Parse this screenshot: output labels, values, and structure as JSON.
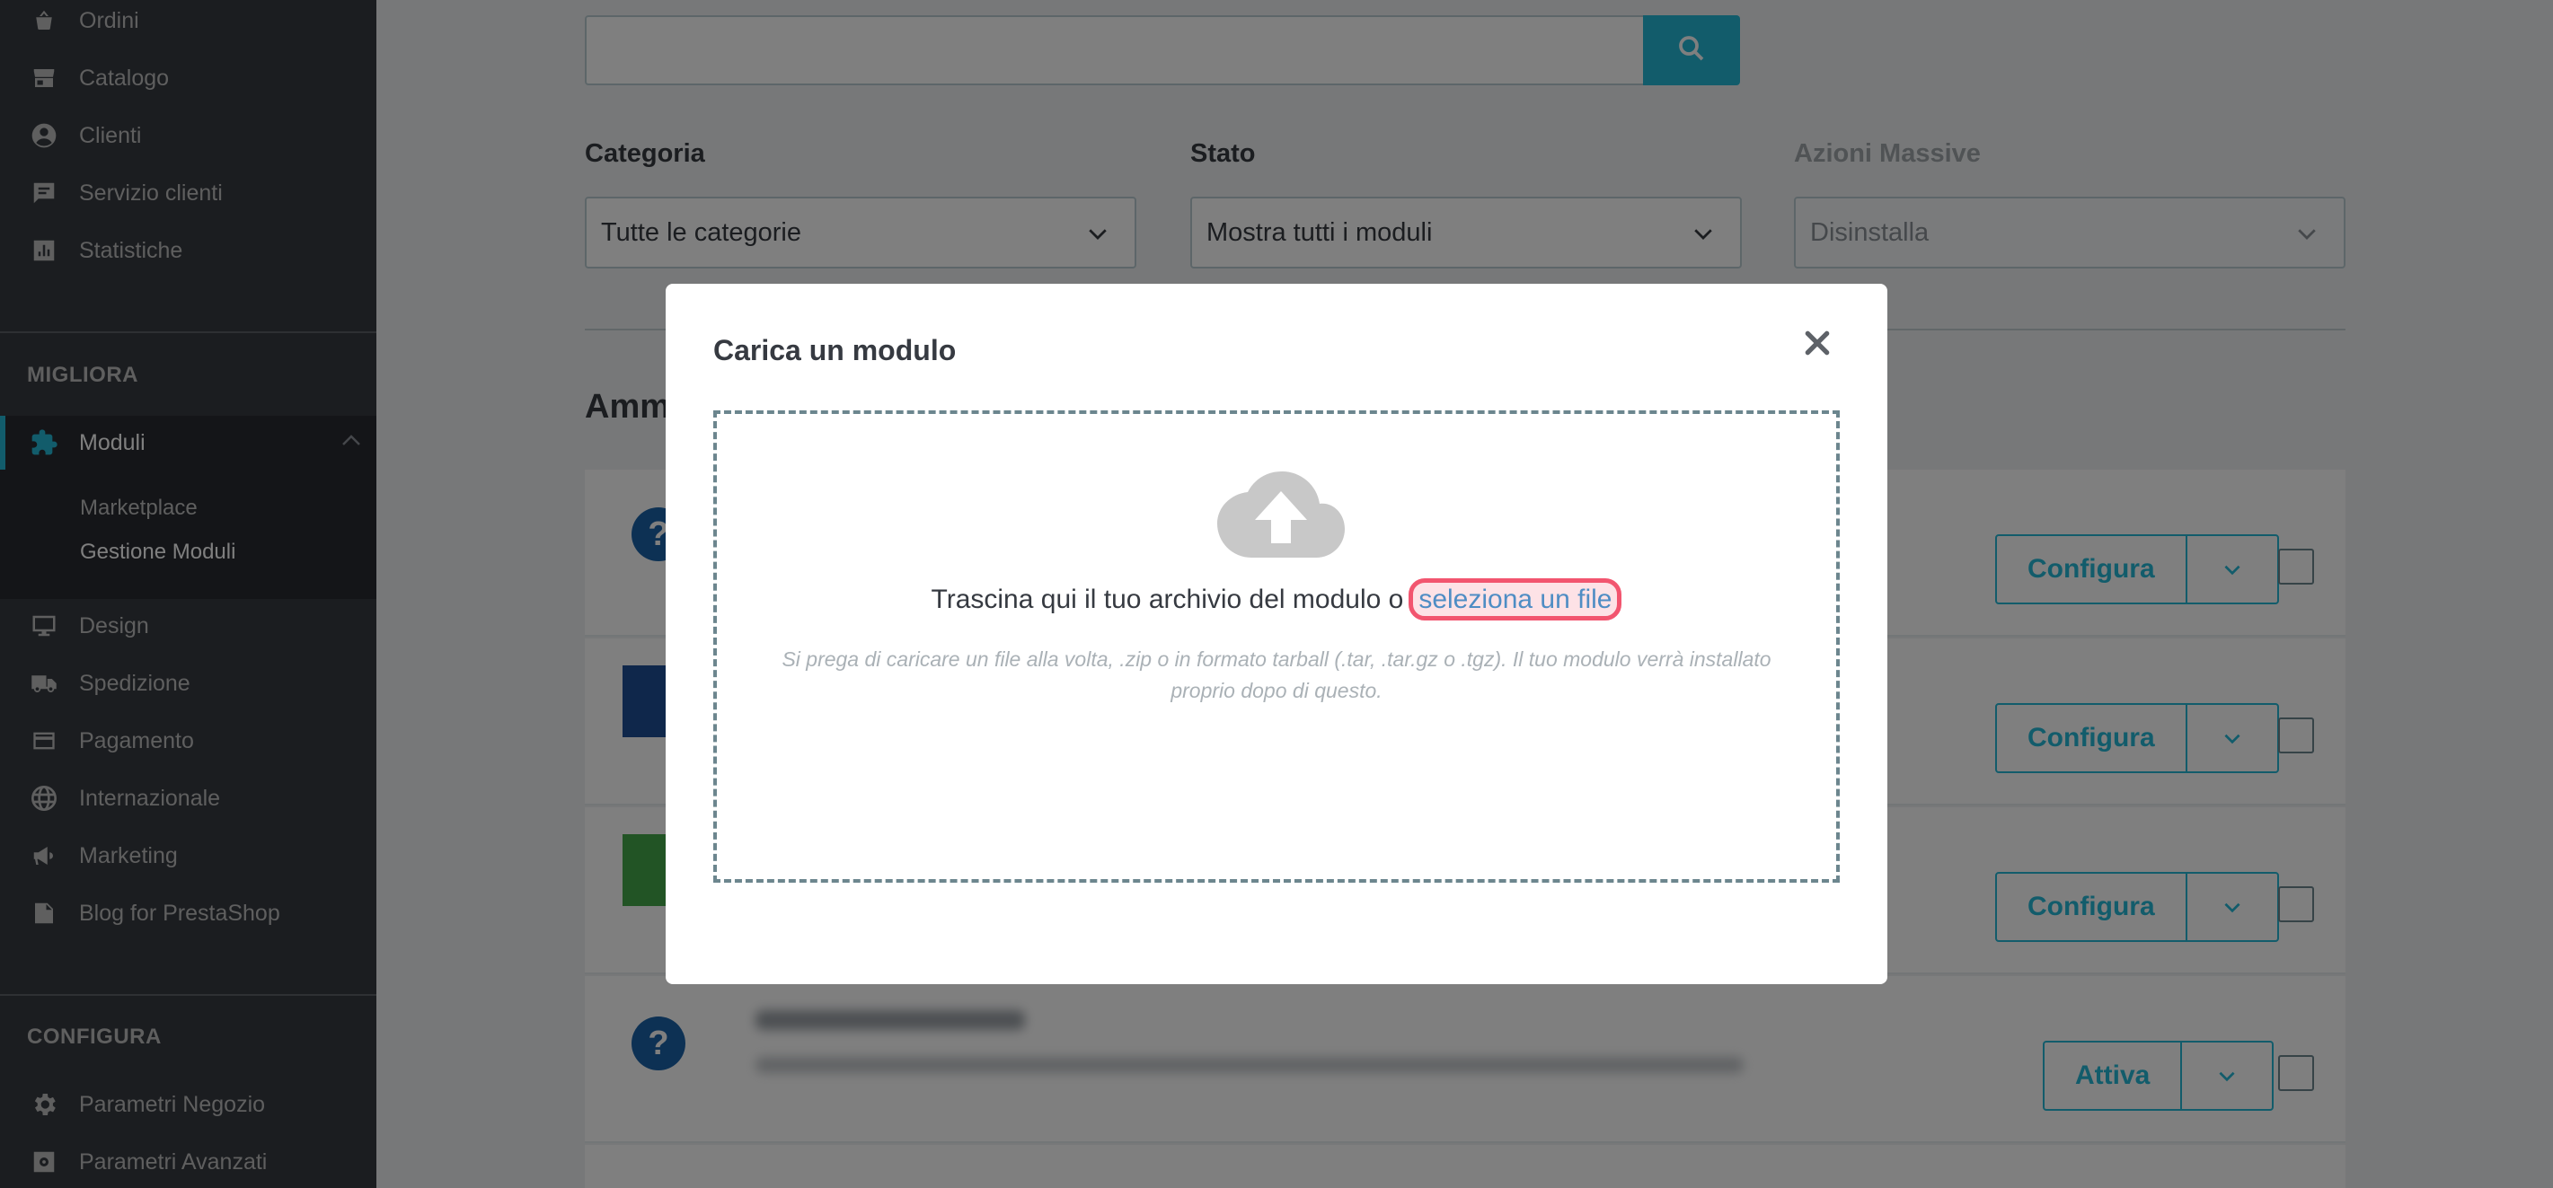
{
  "sidebar": {
    "top_items": [
      {
        "label": "Ordini",
        "icon": "basket-icon"
      },
      {
        "label": "Catalogo",
        "icon": "store-icon"
      },
      {
        "label": "Clienti",
        "icon": "account-icon"
      },
      {
        "label": "Servizio clienti",
        "icon": "chat-icon"
      },
      {
        "label": "Statistiche",
        "icon": "bar-chart-icon"
      }
    ],
    "section_improve": "MIGLIORA",
    "modules_label": "Moduli",
    "sub_items": [
      {
        "label": "Marketplace"
      },
      {
        "label": "Gestione Moduli"
      }
    ],
    "improve_items": [
      {
        "label": "Design",
        "icon": "desktop-icon"
      },
      {
        "label": "Spedizione",
        "icon": "truck-icon"
      },
      {
        "label": "Pagamento",
        "icon": "credit-card-icon"
      },
      {
        "label": "Internazionale",
        "icon": "globe-icon"
      },
      {
        "label": "Marketing",
        "icon": "megaphone-icon"
      },
      {
        "label": "Blog for PrestaShop",
        "icon": "book-icon"
      }
    ],
    "section_configure": "CONFIGURA",
    "configure_items": [
      {
        "label": "Parametri Negozio",
        "icon": "gear-icon"
      },
      {
        "label": "Parametri Avanzati",
        "icon": "settings-box-icon"
      }
    ]
  },
  "main": {
    "filters": {
      "category_label": "Categoria",
      "category_value": "Tutte le categorie",
      "status_label": "Stato",
      "status_value": "Mostra tutti i moduli",
      "bulk_label": "Azioni Massive",
      "bulk_value": "Disinstalla"
    },
    "heading": "Amm",
    "modules": [
      {
        "action": "Configura"
      },
      {
        "action": "Configura"
      },
      {
        "action": "Configura"
      },
      {
        "action": "Attiva"
      }
    ],
    "brand_color": "#25b9d7"
  },
  "modal": {
    "title": "Carica un modulo",
    "drop_text": "Trascina qui il tuo archivio del modulo o",
    "select_link": "seleziona un file",
    "hint": "Si prega di caricare un file alla volta, .zip o in formato tarball (.tar, .tar.gz o .tgz). Il tuo modulo verrà installato proprio dopo di questo.",
    "highlight_color": "#f2556f"
  }
}
